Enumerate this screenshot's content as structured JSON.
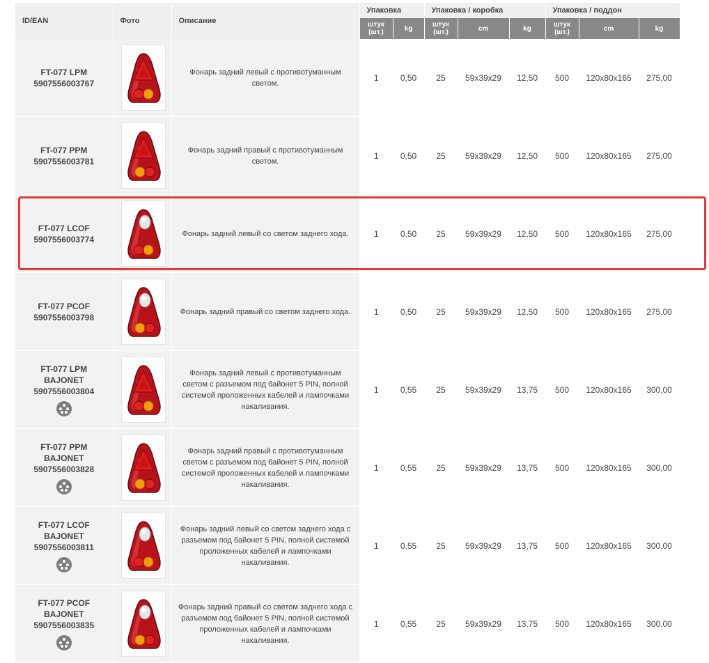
{
  "header": {
    "id_ean": "ID/EAN",
    "foto": "Фото",
    "opisanie": "Описание",
    "group_upakovka": "Упаковка",
    "group_korobka": "Упаковка / коробка",
    "group_poddon": "Упаковка / поддон",
    "sub_pcs": "штук (шт.)",
    "sub_kg": "kg",
    "sub_cm": "cm"
  },
  "rows": [
    {
      "id": "FT-077 LPM",
      "id2": "",
      "ean": "5907556003767",
      "bajonet_icon": false,
      "variant": "left-fog",
      "desc": "Фонарь задний левый с противотуманным светом.",
      "pcs": "1",
      "kg": "0,50",
      "box_pcs": "25",
      "box_cm": "59x39x29",
      "box_kg": "12,50",
      "pal_pcs": "500",
      "pal_cm": "120x80x165",
      "pal_kg": "275,00"
    },
    {
      "id": "FT-077 PPM",
      "id2": "",
      "ean": "5907556003781",
      "bajonet_icon": false,
      "variant": "right-fog",
      "desc": "Фонарь задний правый с противотуманным светом.",
      "pcs": "1",
      "kg": "0,50",
      "box_pcs": "25",
      "box_cm": "59x39x29",
      "box_kg": "12,50",
      "pal_pcs": "500",
      "pal_cm": "120x80x165",
      "pal_kg": "275,00"
    },
    {
      "id": "FT-077 LCOF",
      "id2": "",
      "ean": "5907556003774",
      "bajonet_icon": false,
      "variant": "left-reverse",
      "desc": "Фонарь задний левый со светом заднего хода.",
      "pcs": "1",
      "kg": "0,50",
      "box_pcs": "25",
      "box_cm": "59x39x29",
      "box_kg": "12,50",
      "pal_pcs": "500",
      "pal_cm": "120x80x165",
      "pal_kg": "275,00"
    },
    {
      "id": "FT-077 PCOF",
      "id2": "",
      "ean": "5907556003798",
      "bajonet_icon": false,
      "variant": "right-reverse",
      "desc": "Фонарь задний правый со светом заднего хода.",
      "pcs": "1",
      "kg": "0,50",
      "box_pcs": "25",
      "box_cm": "59x39x29",
      "box_kg": "12,50",
      "pal_pcs": "500",
      "pal_cm": "120x80x165",
      "pal_kg": "275,00"
    },
    {
      "id": "FT-077 LPM",
      "id2": "BAJONET",
      "ean": "5907556003804",
      "bajonet_icon": true,
      "variant": "left-fog",
      "desc": "Фонарь задний левый с противотуманным светом с разъемом под байонет 5 PIN, полной системой проложенных кабелей и лампочками накаливания.",
      "pcs": "1",
      "kg": "0,55",
      "box_pcs": "25",
      "box_cm": "59x39x29",
      "box_kg": "13,75",
      "pal_pcs": "500",
      "pal_cm": "120x80x165",
      "pal_kg": "300,00"
    },
    {
      "id": "FT-077 PPM",
      "id2": "BAJONET",
      "ean": "5907556003828",
      "bajonet_icon": true,
      "variant": "right-fog",
      "desc": "Фонарь задний правый с противотуманным светом с разъемом под байонет 5 PIN, полной системой проложенных кабелей и лампочками накаливания.",
      "pcs": "1",
      "kg": "0,55",
      "box_pcs": "25",
      "box_cm": "59x39x29",
      "box_kg": "13,75",
      "pal_pcs": "500",
      "pal_cm": "120x80x165",
      "pal_kg": "300,00"
    },
    {
      "id": "FT-077 LCOF",
      "id2": "BAJONET",
      "ean": "5907556003811",
      "bajonet_icon": true,
      "variant": "left-reverse",
      "desc": "Фонарь задний левый со светом заднего хода с разъемом под байонет 5 PIN, полной системой проложенных кабелей и лампочками накаливания.",
      "pcs": "1",
      "kg": "0,55",
      "box_pcs": "25",
      "box_cm": "59x39x29",
      "box_kg": "13,75",
      "pal_pcs": "500",
      "pal_cm": "120x80x165",
      "pal_kg": "300,00"
    },
    {
      "id": "FT-077 PCOF",
      "id2": "BAJONET",
      "ean": "5907556003835",
      "bajonet_icon": true,
      "variant": "right-reverse",
      "desc": "Фонарь задний правый со светом заднего хода с разъемом под байонет 5 PIN, полной системой проложенных кабелей и лампочками накаливания.",
      "pcs": "1",
      "kg": "0,55",
      "box_pcs": "25",
      "box_cm": "59x39x29",
      "box_kg": "13,75",
      "pal_pcs": "500",
      "pal_cm": "120x80x165",
      "pal_kg": "300,00"
    }
  ],
  "highlighted_row": 2,
  "colors": {
    "header_sub_bg": "#888888",
    "header_bg": "#efefef",
    "cell_bg": "#f2f2f2",
    "highlight": "#e53935",
    "lamp_red": "#d01515",
    "lamp_amber": "#f39c12"
  }
}
